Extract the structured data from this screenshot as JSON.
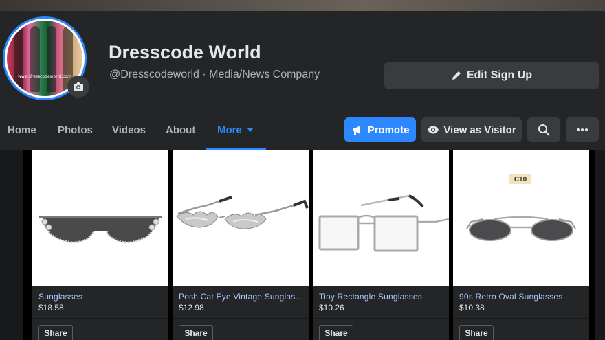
{
  "page": {
    "name": "Dresscode World",
    "subtitle": "@Dresscodeworld · Media/News Company",
    "avatar_text": "www.dresscodeworld.com",
    "edit_button": "Edit Sign Up"
  },
  "nav": {
    "items": [
      "Home",
      "Photos",
      "Videos",
      "About",
      "More"
    ],
    "promote": "Promote",
    "view_as_visitor": "View as Visitor"
  },
  "products": [
    {
      "title": "Sunglasses",
      "price": "$18.58",
      "share": "Share",
      "icon": "half-rim-rhinestone-sunglasses"
    },
    {
      "title": "Posh Cat Eye Vintage Sunglasses",
      "price": "$12.98",
      "share": "Share",
      "icon": "flame-sunglasses"
    },
    {
      "title": "Tiny Rectangle Sunglasses",
      "price": "$10.26",
      "share": "Share",
      "icon": "rectangle-glasses"
    },
    {
      "title": "90s Retro Oval Sunglasses",
      "price": "$10.38",
      "share": "Share",
      "icon": "oval-sunglasses",
      "tag": "C10"
    }
  ],
  "colors": {
    "accent": "#2d88ff",
    "link": "#a6c8ff",
    "background": "#18191a",
    "surface": "#242526"
  }
}
